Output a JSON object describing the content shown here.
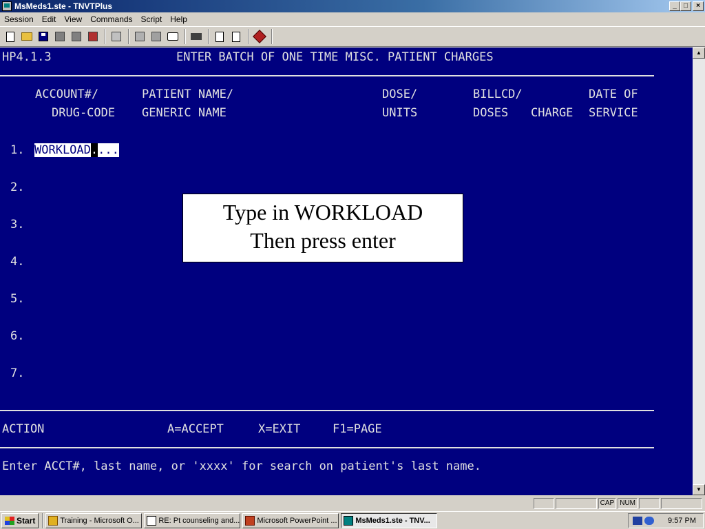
{
  "window": {
    "title": "MsMeds1.ste - TNVTPlus",
    "minimize": "_",
    "maximize": "□",
    "close": "×"
  },
  "menu": [
    "Session",
    "Edit",
    "View",
    "Commands",
    "Script",
    "Help"
  ],
  "toolbar_icons": [
    "new-icon",
    "open-icon",
    "save-icon",
    "settings-icon",
    "properties-icon",
    "macro-icon",
    "print-icon",
    "copy-icon",
    "paste-icon",
    "monitor-icon",
    "keyboard-icon",
    "send-icon",
    "receive-icon",
    "help-book-icon"
  ],
  "terminal": {
    "screen_code": "HP4.1.3",
    "screen_title": "ENTER BATCH OF ONE TIME MISC. PATIENT CHARGES",
    "headers": {
      "row1": {
        "account": "ACCOUNT#/",
        "patient": "PATIENT NAME/",
        "dose": "DOSE/",
        "billcd": "BILLCD/",
        "date": "DATE OF"
      },
      "row2": {
        "drug": "DRUG-CODE",
        "generic": "GENERIC NAME",
        "units": "UNITS",
        "doses": "DOSES",
        "charge": "CHARGE",
        "service": "SERVICE"
      }
    },
    "rows": [
      "1.",
      "2.",
      "3.",
      "4.",
      "5.",
      "6.",
      "7."
    ],
    "input": {
      "value": "WORKLOAD",
      "cursor": ".",
      "fill": "..."
    },
    "action": {
      "label": "ACTION",
      "accept": "A=ACCEPT",
      "exit": "X=EXIT",
      "page": "F1=PAGE"
    },
    "prompt": "Enter ACCT#, last name, or 'xxxx' for search on patient's last name."
  },
  "callout": {
    "line1": "Type in WORKLOAD",
    "line2": "Then press enter"
  },
  "statusbar": {
    "cap": "CAP",
    "num": "NUM"
  },
  "taskbar": {
    "start": "Start",
    "items": [
      {
        "label": "Training - Microsoft O...",
        "icon": "outlook-icon",
        "active": false
      },
      {
        "label": "RE: Pt counseling and...",
        "icon": "mail-icon",
        "active": false
      },
      {
        "label": "Microsoft PowerPoint ...",
        "icon": "powerpoint-icon",
        "active": false
      },
      {
        "label": "MsMeds1.ste - TNV...",
        "icon": "terminal-icon",
        "active": true
      }
    ],
    "clock": "9:57 PM"
  },
  "colors": {
    "terminal_bg": "#00007f",
    "terminal_fg": "#e0e0e0",
    "titlebar": "#0a246a"
  }
}
